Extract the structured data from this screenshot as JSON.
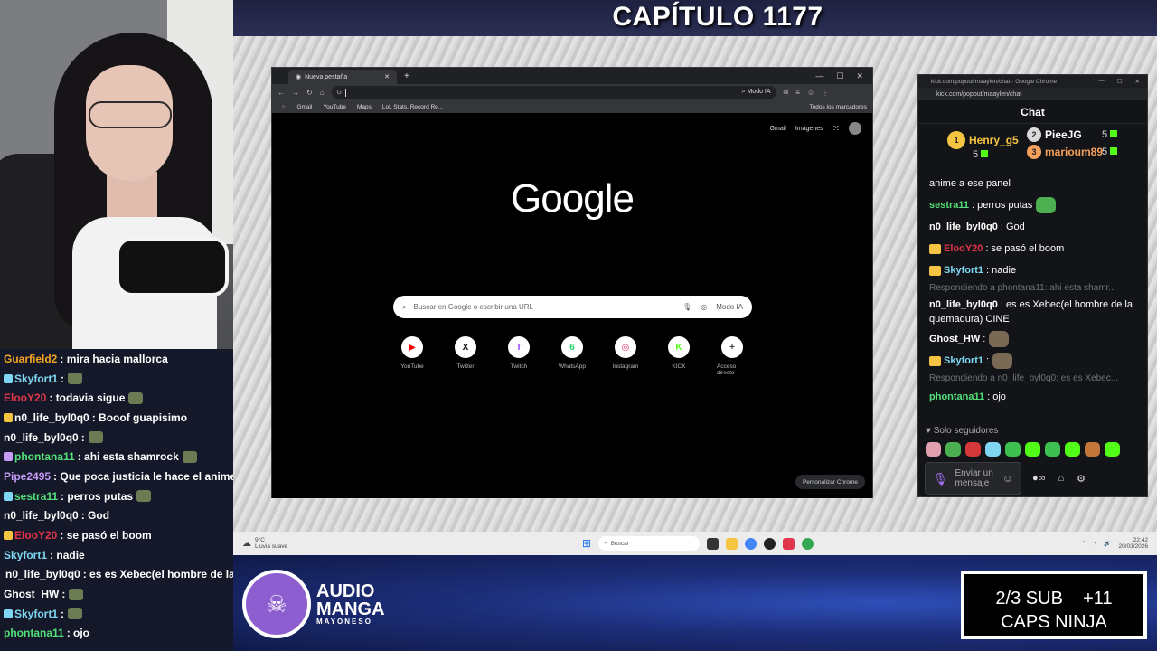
{
  "stream": {
    "chapter_title": "CAPÍTULO 1177",
    "logo": {
      "line1": "AUDIO",
      "line2": "MANGA",
      "line3": "MAYONESO"
    },
    "sub_goal": {
      "line1": "2/3 SUB    +11",
      "line2": "CAPS NINJA"
    }
  },
  "left_chat": [
    {
      "user": "Guarfield2",
      "msg": ": mira hacia mallorca",
      "color": "#f5a623"
    },
    {
      "user": "Skyfort1",
      "msg": ":",
      "color": "#7fd6f2"
    },
    {
      "user": "ElooY20",
      "msg": ": todavia sigue",
      "color": "#e0354a"
    },
    {
      "user": "n0_life_byl0q0",
      "msg": ": Booof guapisimo",
      "color": "#ffffff"
    },
    {
      "user": "n0_life_byl0q0",
      "msg": ":",
      "color": "#ffffff"
    },
    {
      "user": "phontana11",
      "msg": ": ahi esta shamrock",
      "color": "#53e07a"
    },
    {
      "user": "Pipe2495",
      "msg": ": Que poca justicia le hace el anime",
      "color": "#c49bf5"
    },
    {
      "user": "sestra11",
      "msg": ": perros putas",
      "color": "#53e07a"
    },
    {
      "user": "n0_life_byl0q0",
      "msg": ": God",
      "color": "#ffffff"
    },
    {
      "user": "ElooY20",
      "msg": ": se pasó el boom",
      "color": "#e0354a"
    },
    {
      "user": "Skyfort1",
      "msg": ": nadie",
      "color": "#7fd6f2"
    },
    {
      "user": "n0_life_byl0q0",
      "msg": ": es es Xebec(el hombre de la quemadura)",
      "color": "#ffffff"
    },
    {
      "user": "Ghost_HW",
      "msg": ":",
      "color": "#ffffff"
    },
    {
      "user": "Skyfort1",
      "msg": ":",
      "color": "#7fd6f2"
    },
    {
      "user": "phontana11",
      "msg": ": ojo",
      "color": "#53e07a"
    }
  ],
  "chrome": {
    "tab_title": "Nueva pestaña",
    "url_value": "",
    "ai_mode_label": "Modo IA",
    "bookmarks": [
      "Gmail",
      "YouTube",
      "Maps",
      "LoL Stats, Record Re..."
    ],
    "all_bookmarks": "Todos los marcadores",
    "ntp_links": [
      "Gmail",
      "Imágenes"
    ],
    "logo_text": "Google",
    "search_placeholder": "Buscar en Google o escribir una URL",
    "search_ai_label": "Modo IA",
    "shortcuts": [
      {
        "label": "YouTube",
        "icon": "youtube-icon",
        "glyph": "▶",
        "color": "#ff0000"
      },
      {
        "label": "Twitter",
        "icon": "x-icon",
        "glyph": "X",
        "color": "#000000"
      },
      {
        "label": "Twitch",
        "icon": "twitch-icon",
        "glyph": "T",
        "color": "#9146ff"
      },
      {
        "label": "WhatsApp",
        "icon": "whatsapp-icon",
        "glyph": "6",
        "color": "#25d366"
      },
      {
        "label": "Instagram",
        "icon": "instagram-icon",
        "glyph": "◎",
        "color": "#e1306c"
      },
      {
        "label": "KICK",
        "icon": "kick-icon",
        "glyph": "K",
        "color": "#53fc18"
      },
      {
        "label": "Acceso directo",
        "icon": "plus-icon",
        "glyph": "+",
        "color": "#444444"
      }
    ],
    "customize_label": "Personalizar Chrome"
  },
  "taskbar": {
    "weather_temp": "9°C",
    "weather_desc": "Lluvia suave",
    "search_placeholder": "Buscar",
    "time": "22:42",
    "date": "20/03/2026"
  },
  "kick": {
    "window_title": "kick.com/popout/maaylen/chat - Google Chrome",
    "url": "kick.com/popout/maaylen/chat",
    "header": "Chat",
    "leaderboard": [
      {
        "rank": "1",
        "user": "Henry_g5",
        "count": "5",
        "color": "#f5c542"
      },
      {
        "rank": "2",
        "user": "PieeJG",
        "count": "5",
        "color": "#d9d9d9"
      },
      {
        "rank": "3",
        "user": "marioum89",
        "count": "5",
        "color": "#f5a05a"
      }
    ],
    "messages": [
      {
        "type": "plain",
        "text": "anime a ese panel"
      },
      {
        "type": "msg",
        "user": "sestra11",
        "color": "#53e07a",
        "text": ": perros putas"
      },
      {
        "type": "msg",
        "user": "n0_life_byl0q0",
        "color": "#ffffff",
        "text": ": God"
      },
      {
        "type": "msg",
        "user": "ElooY20",
        "color": "#e0354a",
        "text": ": se pasó el boom"
      },
      {
        "type": "msg",
        "user": "Skyfort1",
        "color": "#7fd6f2",
        "text": ": nadie"
      },
      {
        "type": "reply",
        "text": "Respondiendo a phontana11: ahi esta shamr..."
      },
      {
        "type": "wrap",
        "user": "n0_life_byl0q0",
        "color": "#ffffff",
        "text": ": es es Xebec(el hombre de la quemadura) CINE"
      },
      {
        "type": "msg",
        "user": "Ghost_HW",
        "color": "#ffffff",
        "text": ":"
      },
      {
        "type": "msg",
        "user": "Skyfort1",
        "color": "#7fd6f2",
        "text": ":"
      },
      {
        "type": "reply",
        "text": "Respondiendo a n0_life_byl0q0: es es Xebec..."
      },
      {
        "type": "msg",
        "user": "phontana11",
        "color": "#53e07a",
        "text": ": ojo"
      }
    ],
    "followers_only": "Solo seguidores",
    "input_placeholder": "Enviar un mensaje",
    "accent": "#53fc18"
  }
}
